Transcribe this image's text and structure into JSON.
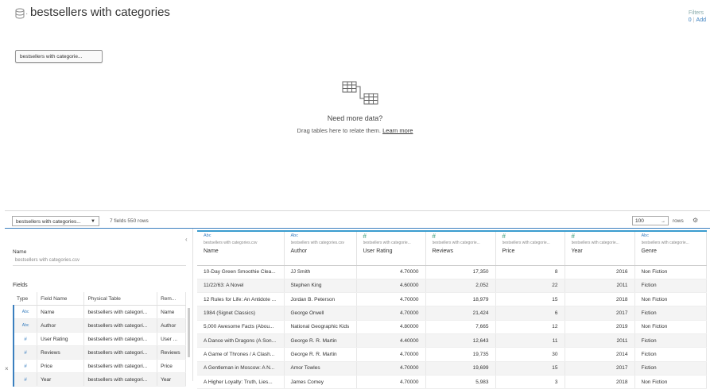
{
  "header": {
    "title": "bestsellers with categories",
    "dot": "·"
  },
  "filters": {
    "label": "Filters",
    "count": "0",
    "add_label": "Add"
  },
  "canvas": {
    "table_pill": "bestsellers with categorie...",
    "need_more": "Need more data?",
    "drag_text": "Drag tables here to relate them.",
    "learn_more": "Learn more"
  },
  "toolbar": {
    "table_select": "bestsellers with categories...",
    "field_count": "7 fields 550 rows",
    "rows_value": "100",
    "rows_label": "rows"
  },
  "left_panel": {
    "name_label": "Name",
    "name_value": "bestsellers with categories.csv",
    "fields_label": "Fields",
    "columns": [
      "Type",
      "Field Name",
      "Physical Table",
      "Rem..."
    ],
    "fields": [
      {
        "type": "Abc",
        "name": "Name",
        "table": "bestsellers with categori...",
        "remote": "Name"
      },
      {
        "type": "Abc",
        "name": "Author",
        "table": "bestsellers with categori...",
        "remote": "Author"
      },
      {
        "type": "#",
        "name": "User Rating",
        "table": "bestsellers with categori...",
        "remote": "User ..."
      },
      {
        "type": "#",
        "name": "Reviews",
        "table": "bestsellers with categori...",
        "remote": "Reviews"
      },
      {
        "type": "#",
        "name": "Price",
        "table": "bestsellers with categori...",
        "remote": "Price"
      },
      {
        "type": "#",
        "name": "Year",
        "table": "bestsellers with categori...",
        "remote": "Year"
      }
    ]
  },
  "grid": {
    "columns": [
      {
        "icon": "Abc",
        "source": "bestsellers with categories.csv",
        "name": "Name"
      },
      {
        "icon": "Abc",
        "source": "bestsellers with categories.csv",
        "name": "Author"
      },
      {
        "icon": "#",
        "source": "bestsellers with categorie...",
        "name": "User Rating"
      },
      {
        "icon": "#",
        "source": "bestsellers with categorie...",
        "name": "Reviews"
      },
      {
        "icon": "#",
        "source": "bestsellers with categorie...",
        "name": "Price"
      },
      {
        "icon": "#",
        "source": "bestsellers with categorie...",
        "name": "Year"
      },
      {
        "icon": "Abc",
        "source": "bestsellers with categorie...",
        "name": "Genre"
      }
    ],
    "rows": [
      [
        "10-Day Green Smoothie Clea...",
        "JJ Smith",
        "4.70000",
        "17,350",
        "8",
        "2016",
        "Non Fiction"
      ],
      [
        "11/22/63: A Novel",
        "Stephen King",
        "4.60000",
        "2,052",
        "22",
        "2011",
        "Fiction"
      ],
      [
        "12 Rules for Life: An Antidote ...",
        "Jordan B. Peterson",
        "4.70000",
        "18,979",
        "15",
        "2018",
        "Non Fiction"
      ],
      [
        "1984 (Signet Classics)",
        "George Orwell",
        "4.70000",
        "21,424",
        "6",
        "2017",
        "Fiction"
      ],
      [
        "5,000 Awesome Facts (Abou...",
        "National Geographic Kids",
        "4.80000",
        "7,665",
        "12",
        "2019",
        "Non Fiction"
      ],
      [
        "A Dance with Dragons (A Son...",
        "George R. R. Martin",
        "4.40000",
        "12,643",
        "11",
        "2011",
        "Fiction"
      ],
      [
        "A Game of Thrones / A Clash...",
        "George R. R. Martin",
        "4.70000",
        "19,735",
        "30",
        "2014",
        "Fiction"
      ],
      [
        "A Gentleman in Moscow: A N...",
        "Amor Towles",
        "4.70000",
        "19,699",
        "15",
        "2017",
        "Fiction"
      ],
      [
        "A Higher Loyalty: Truth, Lies...",
        "James Comey",
        "4.70000",
        "5,983",
        "3",
        "2018",
        "Non Fiction"
      ]
    ]
  }
}
